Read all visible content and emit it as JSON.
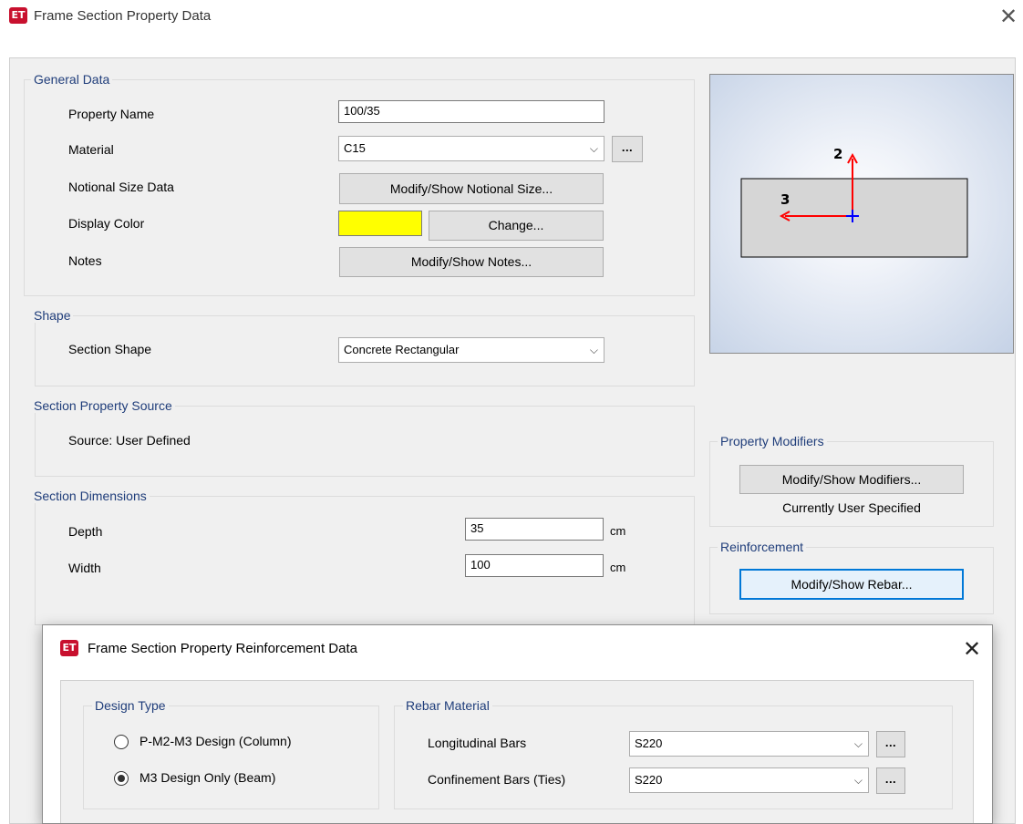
{
  "main_window": {
    "title": "Frame Section Property Data",
    "app_icon_text": "ET",
    "close_glyph": "✕"
  },
  "general_data": {
    "legend": "General Data",
    "property_name_label": "Property Name",
    "property_name_value": "100/35",
    "material_label": "Material",
    "material_value": "C15",
    "material_more": "...",
    "notional_size_label": "Notional Size Data",
    "notional_size_button": "Modify/Show Notional Size...",
    "display_color_label": "Display Color",
    "display_color_value": "#ffff00",
    "change_button": "Change...",
    "notes_label": "Notes",
    "notes_button": "Modify/Show Notes..."
  },
  "shape": {
    "legend": "Shape",
    "section_shape_label": "Section Shape",
    "section_shape_value": "Concrete Rectangular"
  },
  "section_property_source": {
    "legend": "Section Property Source",
    "source_text": "Source:  User Defined"
  },
  "section_dimensions": {
    "legend": "Section Dimensions",
    "depth_label": "Depth",
    "depth_value": "35",
    "depth_unit": "cm",
    "width_label": "Width",
    "width_value": "100",
    "width_unit": "cm"
  },
  "preview": {
    "axis_2_label": "2",
    "axis_3_label": "3",
    "axis_color": "#ff0000",
    "origin_color": "#0000ff"
  },
  "property_modifiers": {
    "legend": "Property Modifiers",
    "button": "Modify/Show Modifiers...",
    "status": "Currently User Specified"
  },
  "reinforcement": {
    "legend": "Reinforcement",
    "button": "Modify/Show Rebar..."
  },
  "rebar_dialog": {
    "title": "Frame Section Property Reinforcement Data",
    "app_icon_text": "ET",
    "close_glyph": "✕",
    "design_type": {
      "legend": "Design Type",
      "options": [
        {
          "label": "P-M2-M3 Design  (Column)",
          "selected": false
        },
        {
          "label": "M3 Design Only  (Beam)",
          "selected": true
        }
      ]
    },
    "rebar_material": {
      "legend": "Rebar Material",
      "longitudinal_label": "Longitudinal Bars",
      "longitudinal_value": "S220",
      "confinement_label": "Confinement Bars (Ties)",
      "confinement_value": "S220",
      "more": "..."
    }
  },
  "icons": {
    "chevron": "chevron-down-icon",
    "close": "close-icon",
    "app": "etabs-app-icon"
  }
}
